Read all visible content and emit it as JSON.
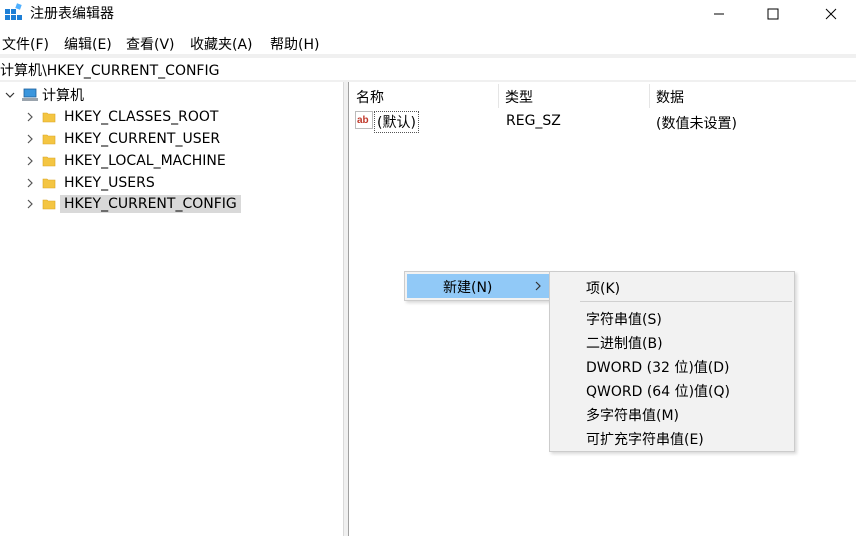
{
  "window": {
    "title": "注册表编辑器"
  },
  "menu": {
    "items": [
      "文件(F)",
      "编辑(E)",
      "查看(V)",
      "收藏夹(A)",
      "帮助(H)"
    ]
  },
  "address": {
    "path": "计算机\\HKEY_CURRENT_CONFIG"
  },
  "tree": {
    "root": "计算机",
    "children": [
      "HKEY_CLASSES_ROOT",
      "HKEY_CURRENT_USER",
      "HKEY_LOCAL_MACHINE",
      "HKEY_USERS",
      "HKEY_CURRENT_CONFIG"
    ],
    "selected": "HKEY_CURRENT_CONFIG"
  },
  "values": {
    "headers": {
      "name": "名称",
      "type": "类型",
      "data": "数据"
    },
    "rows": [
      {
        "name": "(默认)",
        "type": "REG_SZ",
        "data": "(数值未设置)"
      }
    ]
  },
  "context_menu": {
    "new_label": "新建(N)",
    "submenu": [
      "项(K)",
      "字符串值(S)",
      "二进制值(B)",
      "DWORD (32 位)值(D)",
      "QWORD (64 位)值(Q)",
      "多字符串值(M)",
      "可扩充字符串值(E)"
    ]
  },
  "colors": {
    "accent_highlight": "#91c9f7",
    "selected_item": "#d9d9d9",
    "folder": "#f4c542",
    "menu_background": "#f2f2f2"
  }
}
